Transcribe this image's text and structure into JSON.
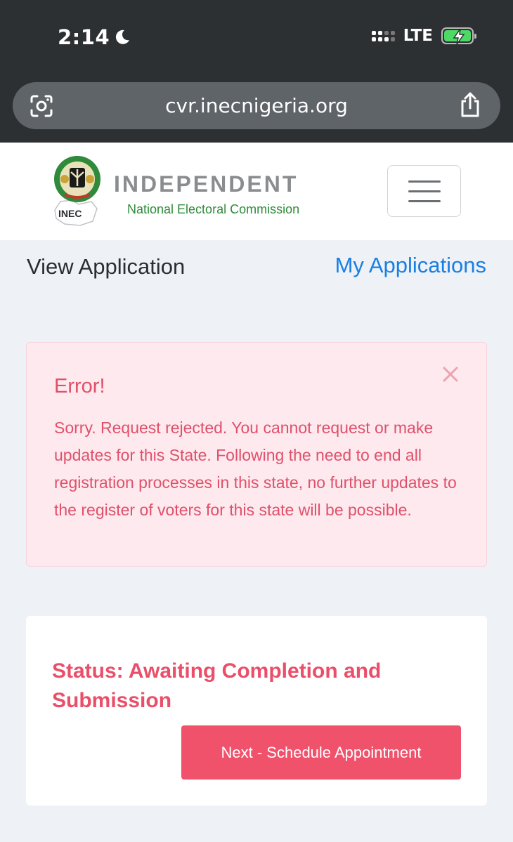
{
  "status_bar": {
    "time": "2:14",
    "network": "LTE",
    "icons": [
      "moon-icon",
      "signal-icon",
      "battery-charging-icon"
    ]
  },
  "browser": {
    "url": "cvr.inecnigeria.org",
    "icons": [
      "camera-lens-icon",
      "share-icon"
    ]
  },
  "navbar": {
    "brand_title": "INDEPENDENT",
    "brand_subtitle": "National Electoral Commission",
    "logo_text": "INEC",
    "menu_icon": "hamburger-menu-icon"
  },
  "header": {
    "title": "View Application",
    "my_applications_link": "My Applications"
  },
  "alert": {
    "title": "Error!",
    "message": "Sorry. Request rejected. You cannot request or make updates for this State. Following the need to end all registration processes in this state, no further updates to the register of voters for this state will be possible.",
    "close_icon": "close-icon"
  },
  "card": {
    "status": "Status: Awaiting Completion and Submission",
    "next_button_label": "Next - Schedule Appointment"
  },
  "colors": {
    "chrome_bg": "#2d3033",
    "link_blue": "#1a7fe3",
    "error_text": "#e0506a",
    "error_bg": "#fde9ee",
    "button_red": "#f0526c",
    "brand_green": "#2e8b3a"
  }
}
